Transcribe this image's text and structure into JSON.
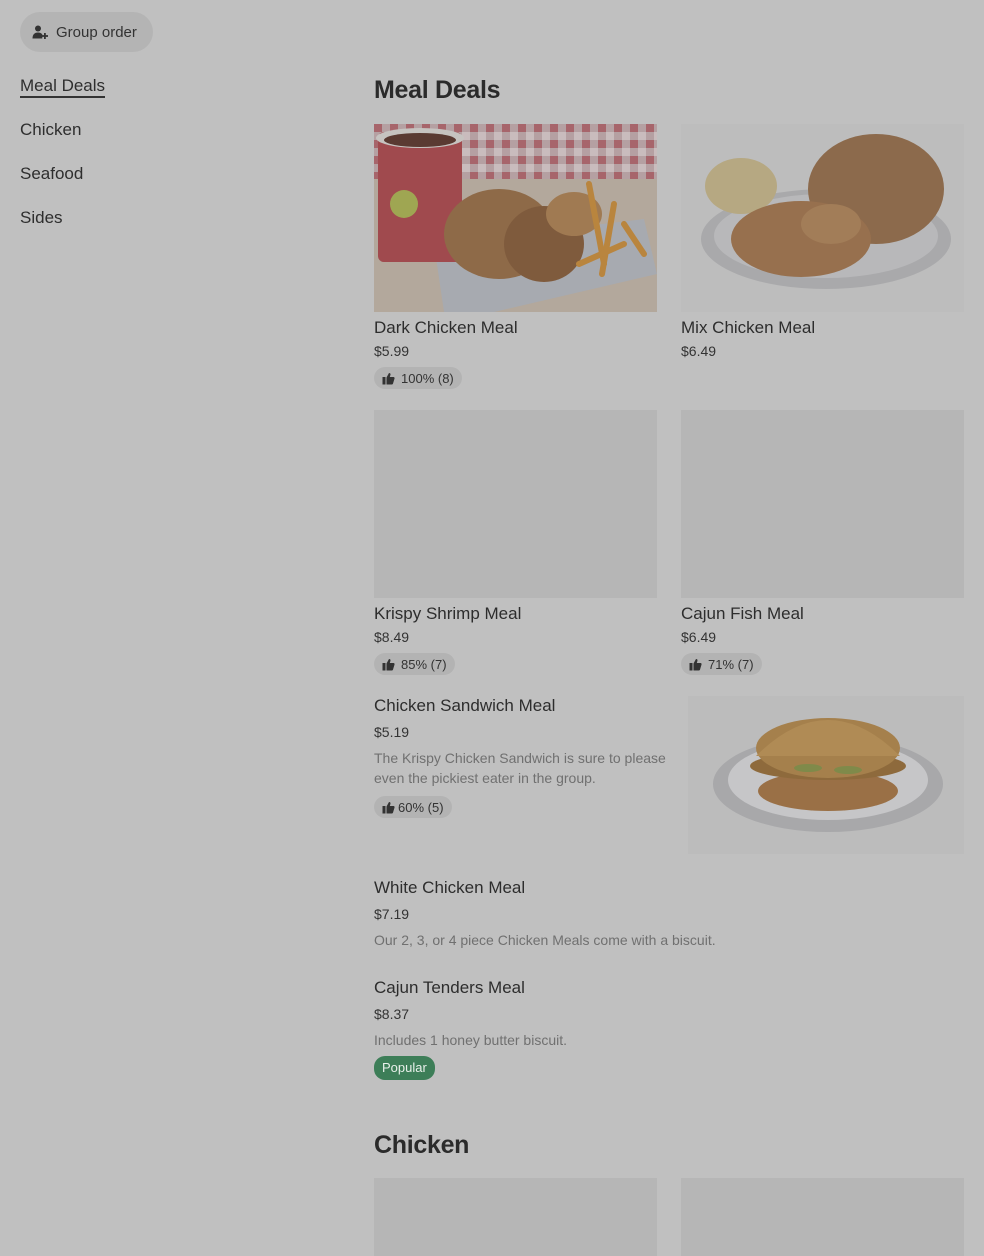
{
  "group_order": {
    "label": "Group order",
    "icon": "add-person-icon"
  },
  "sidebar": {
    "items": [
      {
        "label": "Meal Deals",
        "active": true
      },
      {
        "label": "Chicken",
        "active": false
      },
      {
        "label": "Seafood",
        "active": false
      },
      {
        "label": "Sides",
        "active": false
      }
    ]
  },
  "sections": {
    "meal_deals": {
      "title": "Meal Deals"
    },
    "chicken": {
      "title": "Chicken"
    }
  },
  "cards": [
    {
      "name": "Dark Chicken Meal",
      "price": "$5.99",
      "rating": "100% (8)",
      "image": "chicken-basket-with-fries-and-drink"
    },
    {
      "name": "Mix Chicken Meal",
      "price": "$6.49",
      "rating": "",
      "image": "fried-chicken-with-biscuit-on-plate"
    },
    {
      "name": "Krispy Shrimp Meal",
      "price": "$8.49",
      "rating": "85% (7)",
      "image": ""
    },
    {
      "name": "Cajun Fish Meal",
      "price": "$6.49",
      "rating": "71% (7)",
      "image": ""
    }
  ],
  "rows": [
    {
      "name": "Chicken Sandwich Meal",
      "price": "$5.19",
      "desc_line1": "The Krispy Chicken Sandwich is sure to please",
      "desc_line2": "even the pickiest eater in the group.",
      "rating": "60% (5)",
      "image": "chicken-sandwich-on-plate"
    },
    {
      "name": "White Chicken Meal",
      "price": "$7.19",
      "desc": "Our 2, 3, or 4 piece Chicken Meals come with a biscuit."
    },
    {
      "name": "Cajun Tenders Meal",
      "price": "$8.37",
      "desc": "Includes 1 honey butter biscuit.",
      "badge": "Popular"
    }
  ],
  "colors": {
    "background": "#c0c0c0",
    "popular_badge": "#3d7e58",
    "chip": "#b3b3b3"
  }
}
